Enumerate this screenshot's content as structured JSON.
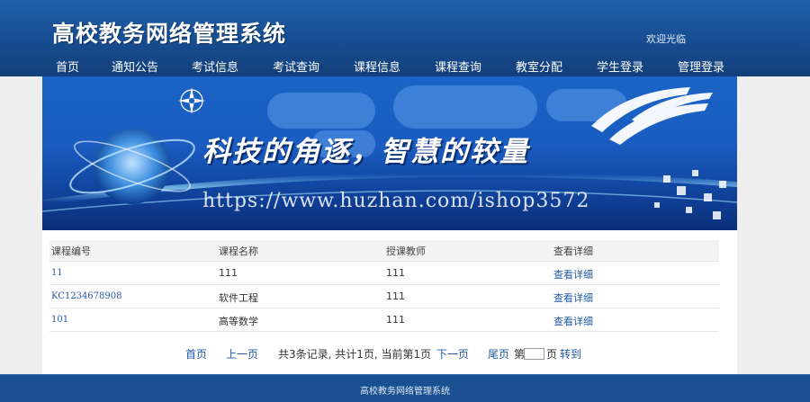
{
  "header": {
    "site_title": "高校教务网络管理系统",
    "welcome": "欢迎光临"
  },
  "nav": {
    "items": [
      "首页",
      "通知公告",
      "考试信息",
      "考试查询",
      "课程信息",
      "课程查询",
      "教室分配",
      "学生登录",
      "管理登录"
    ]
  },
  "banner": {
    "slogan": "科技的角逐，智慧的较量",
    "watermark": "https://www.huzhan.com/ishop3572"
  },
  "table": {
    "headers": [
      "课程编号",
      "课程名称",
      "授课教师",
      "查看详细"
    ],
    "rows": [
      {
        "code": "11",
        "name": "111",
        "teacher": "111",
        "action": "查看详细"
      },
      {
        "code": "KC1234678908",
        "name": "软件工程",
        "teacher": "111",
        "action": "查看详细"
      },
      {
        "code": "101",
        "name": "高等数学",
        "teacher": "111",
        "action": "查看详细"
      }
    ]
  },
  "pager": {
    "first": "首页",
    "prev": "上一页",
    "summary": "共3条记录, 共计1页, 当前第1页",
    "next": "下一页",
    "last": "尾页",
    "page_prefix": "第",
    "page_value": "",
    "page_suffix": "页",
    "go": "转到"
  },
  "footer": {
    "text": "高校教务网络管理系统"
  },
  "colors": {
    "header_blue": "#174d90",
    "link_blue": "#1f5aa6",
    "footer_blue": "#1a4f92"
  }
}
